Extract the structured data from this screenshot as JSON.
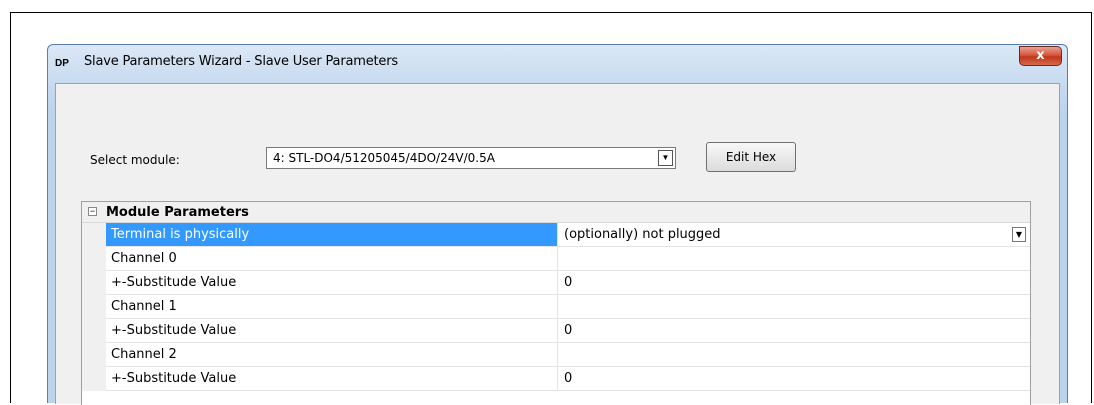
{
  "window": {
    "icon_text": "DP",
    "title": "Slave Parameters Wizard - Slave User Parameters",
    "close_glyph": "x"
  },
  "module": {
    "label": "Select module:",
    "selected": "4: STL-DO4/51205045/4DO/24V/0.5A"
  },
  "buttons": {
    "edit_hex": "Edit Hex"
  },
  "grid": {
    "group_title": "Module Parameters",
    "rows": [
      {
        "name": "Terminal is physically",
        "value": "(optionally) not plugged"
      },
      {
        "name": "Channel 0",
        "value": ""
      },
      {
        "name": "+-Substitude Value",
        "value": "0"
      },
      {
        "name": "Channel 1",
        "value": ""
      },
      {
        "name": "+-Substitude Value",
        "value": "0"
      },
      {
        "name": "Channel 2",
        "value": ""
      },
      {
        "name": "+-Substitude Value",
        "value": "0"
      }
    ]
  },
  "icons": {
    "dropdown_arrow": "▼",
    "collapse": "−"
  },
  "colors": {
    "selection": "#3399ff",
    "close_button": "#c7432a"
  }
}
